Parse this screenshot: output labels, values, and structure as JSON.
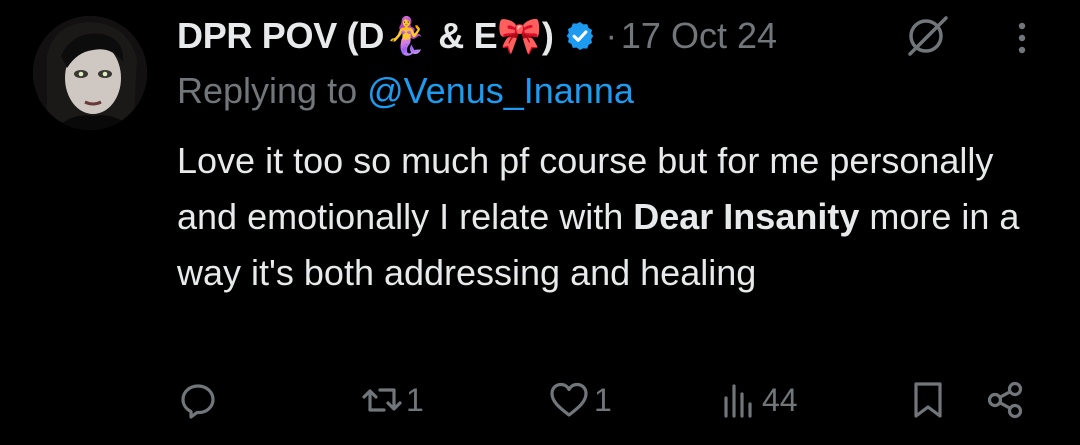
{
  "tweet": {
    "display_name": "DPR POV (D🧜‍♀️ & E🎀)",
    "timestamp": "17 Oct 24",
    "separator": "·",
    "replying_prefix": "Replying to ",
    "replying_handle": "@Venus_Inanna",
    "text_part1": "Love it too so much pf course but for me personally and emotionally I relate with ",
    "text_bold": "Dear Insanity",
    "text_part2": " more in a way it's both addressing and healing",
    "avatar_icon": "avatar",
    "verified_icon": "verified-badge-icon",
    "grok_icon": "grok-icon",
    "more_icon": "more-options-icon"
  },
  "actions": {
    "reply_count": "",
    "repost_count": "1",
    "like_count": "1",
    "views_count": "44"
  },
  "colors": {
    "background": "#000000",
    "text": "#e7e9ea",
    "muted": "#71767b",
    "accent": "#1d9bf0"
  }
}
